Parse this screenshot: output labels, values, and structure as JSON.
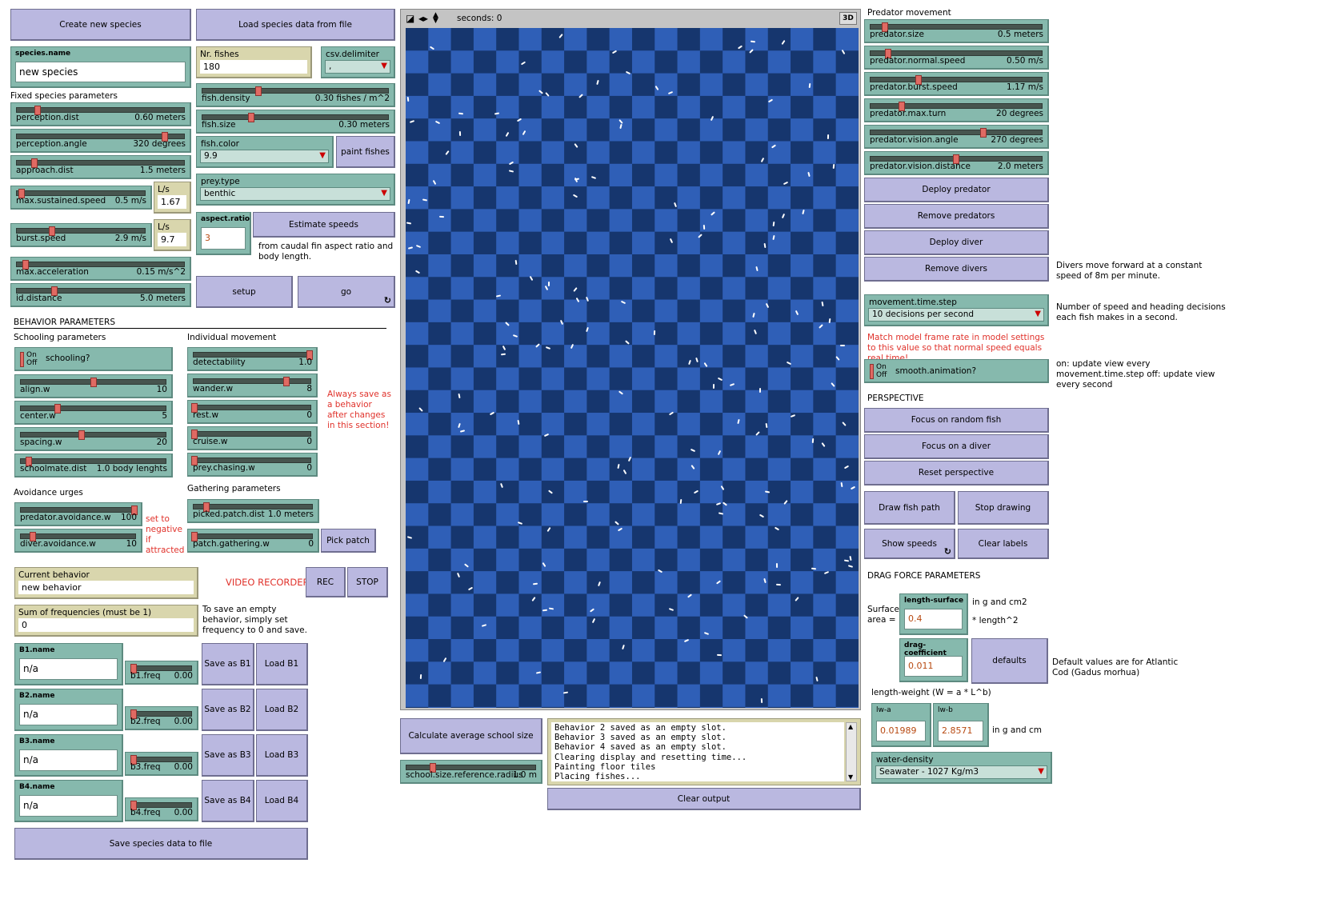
{
  "left": {
    "create_species": "Create new species",
    "load_species": "Load species data from file",
    "species_name": {
      "label": "species.name",
      "value": "new species"
    },
    "nr_fishes": {
      "label": "Nr. fishes",
      "value": "180"
    },
    "csv_delimiter": {
      "label": "csv.delimiter",
      "value": ","
    },
    "fixed_header": "Fixed species parameters",
    "perception_dist": {
      "label": "perception.dist",
      "value": "0.60 meters",
      "pos": 0.12
    },
    "perception_angle": {
      "label": "perception.angle",
      "value": "320 degrees",
      "pos": 0.89
    },
    "approach_dist": {
      "label": "approach.dist",
      "value": "1.5 meters",
      "pos": 0.1
    },
    "max_sustained_speed": {
      "label": "max.sustained.speed",
      "value": "0.5 m/s",
      "pos": 0.03
    },
    "ls1": {
      "label": "L/s",
      "value": "1.67"
    },
    "burst_speed": {
      "label": "burst.speed",
      "value": "2.9 m/s",
      "pos": 0.27
    },
    "ls2": {
      "label": "L/s",
      "value": "9.7"
    },
    "max_acceleration": {
      "label": "max.acceleration",
      "value": "0.15 m/s^2",
      "pos": 0.05
    },
    "id_distance": {
      "label": "id.distance",
      "value": "5.0 meters",
      "pos": 0.22
    },
    "fish_density": {
      "label": "fish.density",
      "value": "0.30 fishes / m^2",
      "pos": 0.3
    },
    "fish_size": {
      "label": "fish.size",
      "value": "0.30 meters",
      "pos": 0.26
    },
    "fish_color": {
      "label": "fish.color",
      "value": "9.9"
    },
    "paint_fishes": "paint fishes",
    "prey_type": {
      "label": "prey.type",
      "value": "benthic"
    },
    "aspect_ratio": {
      "label": "aspect.ratio",
      "value": "3"
    },
    "estimate_speeds": "Estimate speeds",
    "estimate_note": "from caudal fin aspect ratio and body length.",
    "setup": "setup",
    "go": "go",
    "behavior_header": "BEHAVIOR PARAMETERS",
    "schooling_header": "Schooling parameters",
    "schooling_switch": {
      "on": "On",
      "off": "Off",
      "label": "schooling?"
    },
    "align_w": {
      "label": "align.w",
      "value": "10",
      "pos": 0.5
    },
    "center_w": {
      "label": "center.w",
      "value": "5",
      "pos": 0.25
    },
    "spacing_w": {
      "label": "spacing.w",
      "value": "20",
      "pos": 0.42
    },
    "schoolmate_dist": {
      "label": "schoolmate.dist",
      "value": "1.0 body lenghts",
      "pos": 0.05
    },
    "individual_header": "Individual movement",
    "detectability": {
      "label": "detectability",
      "value": "1.0",
      "pos": 1.0
    },
    "wander_w": {
      "label": "wander.w",
      "value": "8",
      "pos": 0.8
    },
    "rest_w": {
      "label": "rest.w",
      "value": "0",
      "pos": 0.0
    },
    "cruise_w": {
      "label": "cruise.w",
      "value": "0",
      "pos": 0.0
    },
    "prey_chasing_w": {
      "label": "prey.chasing.w",
      "value": "0",
      "pos": 0.0
    },
    "always_save_note": "Always save as a behavior after changes in this section!",
    "avoidance_header": "Avoidance urges",
    "predator_avoidance_w": {
      "label": "predator.avoidance.w",
      "value": "100",
      "pos": 1.0
    },
    "diver_avoidance_w": {
      "label": "diver.avoidance.w",
      "value": "10",
      "pos": 0.1
    },
    "negative_note": "set to negative if attracted",
    "gathering_header": "Gathering parameters",
    "picked_patch_dist": {
      "label": "picked.patch.dist",
      "value": "1.0 meters",
      "pos": 0.1
    },
    "patch_gathering_w": {
      "label": "patch.gathering.w",
      "value": "0",
      "pos": 0.0
    },
    "pick_patch": "Pick patch",
    "current_behavior": {
      "label": "Current behavior",
      "value": "new behavior"
    },
    "video_recorder": "VIDEO RECORDER",
    "rec": "REC",
    "stop": "STOP",
    "sum_freq": {
      "label": "Sum of frequencies (must be 1)",
      "value": "0"
    },
    "empty_note": "To save an empty behavior, simply set frequency to 0 and save.",
    "behaviors": [
      {
        "name_label": "B1.name",
        "name": "n/a",
        "freq_label": "b1.freq",
        "freq": "0.00",
        "save": "Save as B1",
        "load": "Load B1"
      },
      {
        "name_label": "B2.name",
        "name": "n/a",
        "freq_label": "b2.freq",
        "freq": "0.00",
        "save": "Save as B2",
        "load": "Load B2"
      },
      {
        "name_label": "B3.name",
        "name": "n/a",
        "freq_label": "b3.freq",
        "freq": "0.00",
        "save": "Save as B3",
        "load": "Load B3"
      },
      {
        "name_label": "B4.name",
        "name": "n/a",
        "freq_label": "b4.freq",
        "freq": "0.00",
        "save": "Save as B4",
        "load": "Load B4"
      }
    ],
    "save_species": "Save species data to file"
  },
  "world": {
    "seconds": "seconds: 0",
    "btn_3d": "3D",
    "tile_colors": [
      "#2f5fb7",
      "#16366e"
    ],
    "fish_color": "#ffffff"
  },
  "bottom": {
    "calc_school": "Calculate average school size",
    "school_radius": {
      "label": "school.size.reference.radius",
      "value": "1.0 m",
      "pos": 0.2
    },
    "output_lines": [
      "Behavior 2 saved as an empty slot.",
      "Behavior 3 saved as an empty slot.",
      "Behavior 4 saved as an empty slot.",
      "Clearing display and resetting time...",
      "Painting floor tiles",
      "Placing fishes..."
    ],
    "clear_output": "Clear output"
  },
  "right": {
    "predator_header": "Predator movement",
    "predator_size": {
      "label": "predator.size",
      "value": "0.5 meters",
      "pos": 0.08
    },
    "predator_normal_speed": {
      "label": "predator.normal.speed",
      "value": "0.50 m/s",
      "pos": 0.1
    },
    "predator_burst_speed": {
      "label": "predator.burst.speed",
      "value": "1.17 m/s",
      "pos": 0.28
    },
    "predator_max_turn": {
      "label": "predator.max.turn",
      "value": "20 degrees",
      "pos": 0.18
    },
    "predator_vision_angle": {
      "label": "predator.vision.angle",
      "value": "270 degrees",
      "pos": 0.66
    },
    "predator_vision_distance": {
      "label": "predator.vision.distance",
      "value": "2.0 meters",
      "pos": 0.5
    },
    "deploy_predator": "Deploy predator",
    "remove_predators": "Remove predators",
    "deploy_diver": "Deploy diver",
    "remove_divers": "Remove divers",
    "divers_note": "Divers move forward at a constant speed of 8m per minute.",
    "movement_time_step": {
      "label": "movement.time.step",
      "value": "10 decisions per second"
    },
    "decisions_note": "Number of speed and heading decisions each fish makes in a second.",
    "frame_rate_note": "Match model frame rate in model settings to this value so that normal speed equals real time!",
    "smooth_switch": {
      "on": "On",
      "off": "Off",
      "label": "smooth.animation?"
    },
    "smooth_note": "on: update view every movement.time.step off: update view every second",
    "perspective_header": "PERSPECTIVE",
    "focus_random": "Focus on random fish",
    "focus_diver": "Focus on a diver",
    "reset_perspective": "Reset perspective",
    "draw_path": "Draw fish path",
    "stop_drawing": "Stop drawing",
    "show_speeds": "Show speeds",
    "clear_labels": "Clear labels",
    "drag_header": "DRAG FORCE PARAMETERS",
    "surface_area": "Surface area =",
    "length_surface": {
      "label": "length-surface",
      "value": "0.4"
    },
    "g_cm2_note": "in g and cm2",
    "length_sq": "* length^2",
    "drag_coefficient": {
      "label": "drag-coefficient",
      "value": "0.011"
    },
    "defaults": "defaults",
    "defaults_note": "Default values are for Atlantic Cod (Gadus morhua)",
    "length_weight": "length-weight (W = a * L^b)",
    "lw_a": {
      "label": "lw-a",
      "value": "0.01989"
    },
    "lw_b": {
      "label": "lw-b",
      "value": "2.8571"
    },
    "g_cm_note": "in g and cm",
    "water_density": {
      "label": "water-density",
      "value": "Seawater - 1027 Kg/m3"
    }
  }
}
